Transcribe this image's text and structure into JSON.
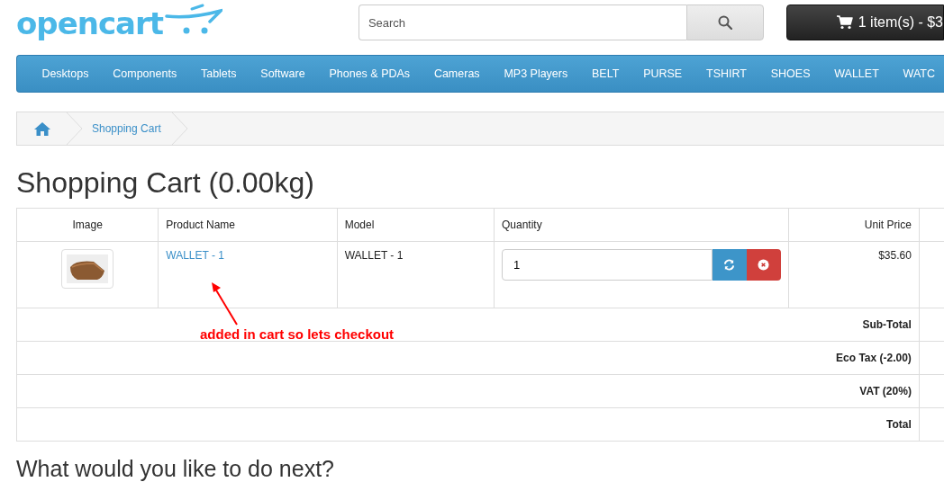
{
  "header": {
    "logo": "opencart",
    "search": {
      "placeholder": "Search"
    },
    "cart_button": "1 item(s) - $3"
  },
  "menu": [
    "Desktops",
    "Components",
    "Tablets",
    "Software",
    "Phones & PDAs",
    "Cameras",
    "MP3 Players",
    "BELT",
    "PURSE",
    "TSHIRT",
    "SHOES",
    "WALLET",
    "WATC"
  ],
  "breadcrumb": [
    "Shopping Cart"
  ],
  "title": "Shopping Cart (0.00kg)",
  "cart_table": {
    "columns": [
      "Image",
      "Product Name",
      "Model",
      "Quantity",
      "Unit Price"
    ],
    "rows": [
      {
        "product_name": "WALLET - 1",
        "model": "WALLET - 1",
        "quantity": "1",
        "unit_price": "$35.60"
      }
    ],
    "totals": [
      "Sub-Total",
      "Eco Tax (-2.00)",
      "VAT (20%)",
      "Total"
    ]
  },
  "annotation": "added in cart so lets checkout",
  "next_heading": "What would you like to do next?"
}
